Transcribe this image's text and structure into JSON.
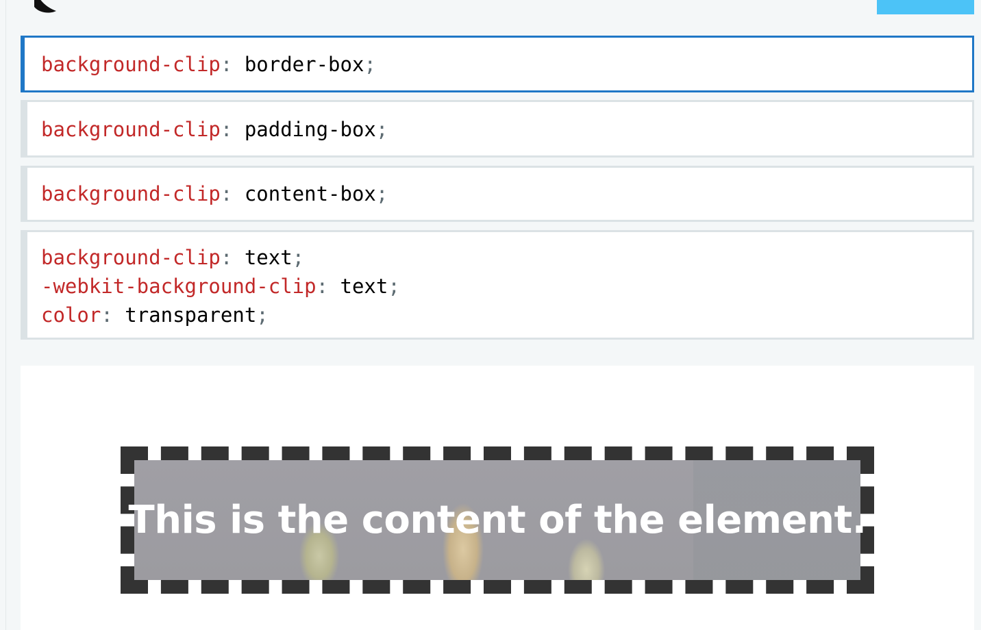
{
  "options": [
    {
      "selected": true,
      "lines": [
        {
          "prop": "background-clip",
          "value": "border-box"
        }
      ]
    },
    {
      "selected": false,
      "lines": [
        {
          "prop": "background-clip",
          "value": "padding-box"
        }
      ]
    },
    {
      "selected": false,
      "lines": [
        {
          "prop": "background-clip",
          "value": "content-box"
        }
      ]
    },
    {
      "selected": false,
      "lines": [
        {
          "prop": "background-clip",
          "value": "text"
        },
        {
          "prop": "-webkit-background-clip",
          "value": "text"
        },
        {
          "prop": "color",
          "value": "transparent"
        }
      ]
    }
  ],
  "output": {
    "demo_text": "This is the content of the element."
  },
  "colors": {
    "property": "#c22828",
    "selected_border": "#1f77c6",
    "top_button": "#4cc3f7"
  },
  "icons": {
    "top_logo": "logo-icon"
  }
}
